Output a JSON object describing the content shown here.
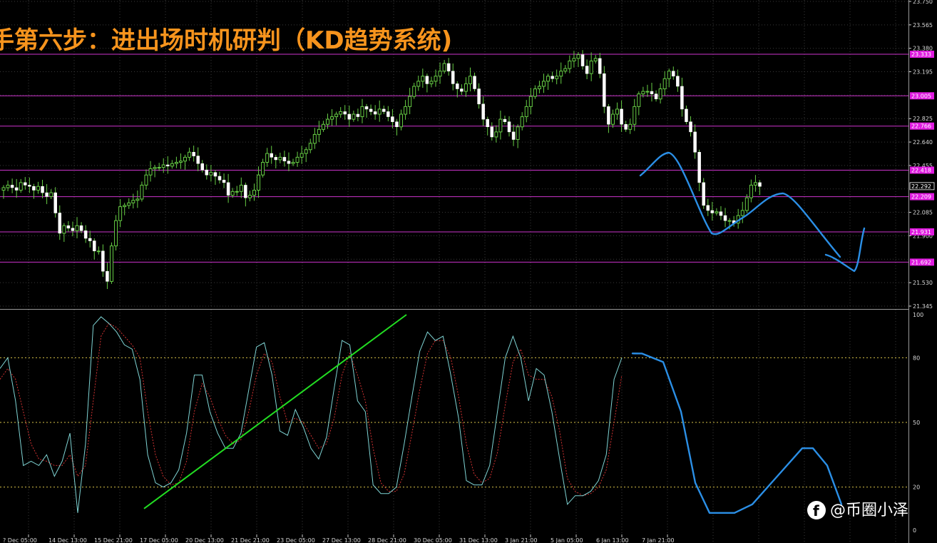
{
  "title": "手第六步：进出场时机研判（KD趋势系统)",
  "watermark": "@币圈小泽",
  "colors": {
    "background": "#000000",
    "bull_candle": "#ffffff",
    "wick": "#66cc44",
    "level_line": "#cc33cc",
    "level_tag": "#e01be0",
    "k_line": "#7fd4d4",
    "d_line": "#d23232",
    "trend_line": "#22dd22",
    "projection": "#2b8fe6",
    "title": "#f7941d",
    "grid": "#3a3a3a",
    "ref_level": "#d9c34a"
  },
  "chart_data": [
    {
      "type": "candlestick",
      "name": "price",
      "y_ticks": [
        23.75,
        23.565,
        23.38,
        23.195,
        23.01,
        22.825,
        22.64,
        22.455,
        22.27,
        22.085,
        21.9,
        21.715,
        21.53,
        21.345
      ],
      "y_tick_labels": [
        "23.750",
        "23.565",
        "23.380",
        "23.195",
        "",
        "22.825",
        "22.640",
        "22.455",
        "",
        "22.085",
        "21.900",
        "",
        "21.530",
        "21.345"
      ],
      "ylim": [
        21.345,
        23.75
      ],
      "current_price": 22.292,
      "current_price_label": "22.292",
      "levels": [
        23.333,
        23.005,
        22.766,
        22.418,
        22.209,
        21.931,
        21.692
      ],
      "level_labels": [
        "23.333",
        "23.005",
        "22.766",
        "22.418",
        "22.209",
        "21.931",
        "21.692"
      ],
      "close": [
        22.28,
        22.3,
        22.28,
        22.26,
        22.32,
        22.3,
        22.29,
        22.26,
        22.29,
        22.24,
        22.21,
        22.24,
        22.08,
        21.92,
        21.98,
        21.96,
        21.94,
        21.98,
        21.94,
        21.88,
        21.86,
        21.78,
        21.78,
        21.62,
        21.54,
        21.82,
        22.02,
        22.13,
        22.14,
        22.16,
        22.18,
        22.19,
        22.3,
        22.38,
        22.43,
        22.44,
        22.44,
        22.46,
        22.45,
        22.47,
        22.48,
        22.49,
        22.52,
        22.56,
        22.53,
        22.47,
        22.42,
        22.38,
        22.4,
        22.37,
        22.34,
        22.32,
        22.22,
        22.25,
        22.25,
        22.3,
        22.2,
        22.22,
        22.26,
        22.38,
        22.48,
        22.55,
        22.52,
        22.5,
        22.52,
        22.49,
        22.47,
        22.48,
        22.52,
        22.55,
        22.58,
        22.63,
        22.7,
        22.74,
        22.78,
        22.82,
        22.84,
        22.86,
        22.88,
        22.86,
        22.82,
        22.86,
        22.84,
        22.92,
        22.9,
        22.88,
        22.86,
        22.9,
        22.88,
        22.84,
        22.8,
        22.76,
        22.86,
        22.92,
        23.0,
        23.08,
        23.12,
        23.16,
        23.1,
        23.12,
        23.16,
        23.2,
        23.26,
        23.2,
        23.1,
        23.06,
        23.04,
        23.1,
        23.16,
        23.06,
        22.94,
        22.82,
        22.76,
        22.68,
        22.72,
        22.82,
        22.8,
        22.72,
        22.66,
        22.76,
        22.84,
        22.92,
        23.0,
        23.06,
        23.08,
        23.12,
        23.16,
        23.14,
        23.16,
        23.2,
        23.22,
        23.28,
        23.3,
        23.33,
        23.24,
        23.18,
        23.28,
        23.3,
        23.18,
        22.92,
        22.78,
        22.86,
        22.9,
        22.78,
        22.74,
        22.78,
        22.92,
        23.02,
        23.04,
        23.04,
        23.02,
        22.98,
        23.06,
        23.14,
        23.2,
        23.16,
        23.08,
        22.9,
        22.8,
        22.72,
        22.56,
        22.32,
        22.14,
        22.1,
        22.08,
        22.09,
        22.06,
        22.02,
        22.02,
        22.0,
        22.06,
        22.1,
        22.2,
        22.3,
        22.32,
        22.29
      ],
      "x_tick_labels": [
        "? Dec 05:00",
        "14 Dec 13:00",
        "15 Dec 21:00",
        "17 Dec 05:00",
        "20 Dec 13:00",
        "21 Dec 21:00",
        "23 Dec 05:00",
        "27 Dec 13:00",
        "28 Dec 21:00",
        "30 Dec 05:00",
        "31 Dec 13:00",
        "3 Jan 21:00",
        "5 Jan 05:00",
        "6 Jan 13:00",
        "7 Jan 21:00"
      ]
    },
    {
      "type": "line",
      "name": "stochastic",
      "ylim": [
        0,
        100
      ],
      "y_ticks": [
        100,
        80,
        50,
        20,
        0
      ],
      "y_tick_labels": [
        "100",
        "80",
        "50",
        "20",
        "0"
      ],
      "ref_levels": [
        80,
        50,
        20
      ],
      "k": [
        75,
        80,
        60,
        30,
        32,
        30,
        35,
        25,
        32,
        45,
        8,
        40,
        95,
        99,
        96,
        92,
        86,
        84,
        70,
        35,
        22,
        20,
        22,
        28,
        45,
        72,
        72,
        55,
        45,
        38,
        38,
        45,
        65,
        85,
        87,
        72,
        46,
        44,
        56,
        48,
        38,
        33,
        43,
        66,
        88,
        86,
        60,
        55,
        21,
        17,
        17,
        20,
        40,
        62,
        83,
        92,
        88,
        90,
        72,
        52,
        23,
        21,
        21,
        30,
        55,
        80,
        90,
        80,
        60,
        75,
        72,
        55,
        33,
        12,
        16,
        16,
        18,
        23,
        35,
        70,
        80
      ],
      "d": [
        70,
        75,
        70,
        55,
        40,
        33,
        32,
        30,
        30,
        35,
        25,
        30,
        60,
        90,
        96,
        94,
        90,
        86,
        80,
        55,
        35,
        25,
        21,
        22,
        32,
        55,
        68,
        62,
        52,
        44,
        40,
        42,
        55,
        72,
        82,
        78,
        62,
        50,
        52,
        50,
        44,
        38,
        40,
        52,
        72,
        82,
        72,
        60,
        38,
        22,
        18,
        18,
        26,
        45,
        65,
        82,
        88,
        88,
        80,
        62,
        40,
        26,
        22,
        24,
        36,
        58,
        78,
        84,
        72,
        70,
        70,
        62,
        46,
        24,
        18,
        16,
        17,
        20,
        28,
        50,
        72
      ],
      "trend_line_values": [
        10,
        100
      ],
      "projection_values": [
        82,
        82,
        78,
        55,
        22,
        8,
        8,
        12,
        25,
        38,
        38,
        30,
        12
      ]
    }
  ]
}
